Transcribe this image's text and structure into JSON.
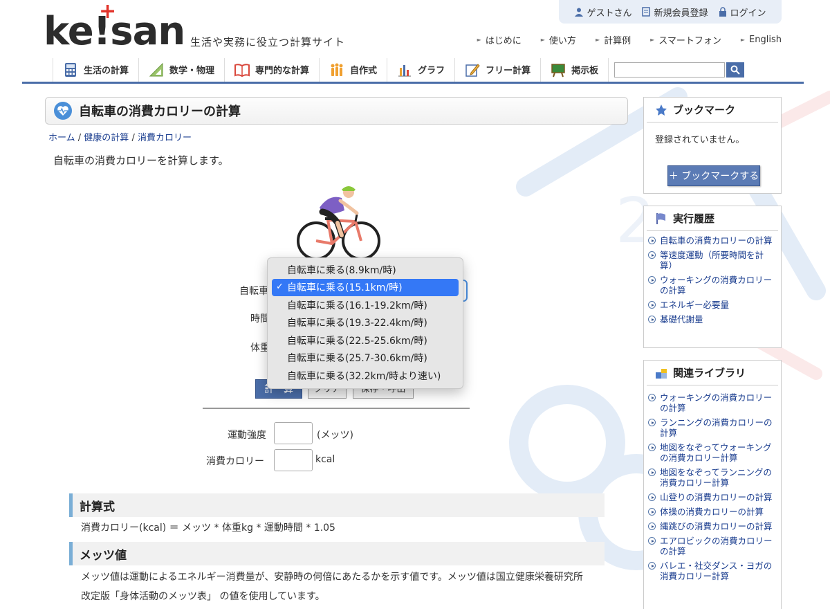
{
  "account": {
    "guest": "ゲストさん",
    "register": "新規会員登録",
    "login": "ログイン"
  },
  "logo": {
    "text_pre": "ke",
    "text_bang": "!",
    "text_post": "san",
    "tagline": "生活や実務に役立つ計算サイト"
  },
  "top_links": [
    "はじめに",
    "使い方",
    "計算例",
    "スマートフォン",
    "English"
  ],
  "nav": {
    "items": [
      "生活の計算",
      "数学・物理",
      "専門的な計算",
      "自作式",
      "グラフ",
      "フリー計算",
      "掲示板"
    ],
    "search_placeholder": ""
  },
  "page": {
    "title": "自転車の消費カロリーの計算",
    "breadcrumb": [
      "ホーム",
      "健康の計算",
      "消費カロリー"
    ],
    "breadcrumb_sep": "/",
    "description": "自転車の消費カロリーを計算します。"
  },
  "form": {
    "label_activity": "自転車",
    "label_time": "時間",
    "label_weight": "体重",
    "dropdown_options": [
      "自転車に乗る(8.9km/時)",
      "自転車に乗る(15.1km/時)",
      "自転車に乗る(16.1-19.2km/時)",
      "自転車に乗る(19.3-22.4km/時)",
      "自転車に乗る(22.5-25.6km/時)",
      "自転車に乗る(25.7-30.6km/時)",
      "自転車に乗る(32.2km/時より速い)"
    ],
    "selected_index": 1,
    "calc_button": "計　算",
    "clear_button": "クリア",
    "save_button": "保存・呼出"
  },
  "output": {
    "intensity_label": "運動強度",
    "intensity_unit": "(メッツ)",
    "calorie_label": "消費カロリー",
    "calorie_unit": "kcal"
  },
  "sections": {
    "formula_heading": "計算式",
    "formula_text": "消費カロリー(kcal) ＝ メッツ * 体重kg * 運動時間 * 1.05",
    "mets_heading": "メッツ値",
    "mets_text": "メッツ値は運動によるエネルギー消費量が、安静時の何倍にあたるかを示す値です。メッツ値は国立健康栄養研究所　改定版「身体活動のメッツ表」 の値を使用しています。"
  },
  "sidebar": {
    "bookmark_title": "ブックマーク",
    "bookmark_empty": "登録されていません。",
    "bookmark_button": "＋ ブックマークする",
    "history_title": "実行履歴",
    "history_items": [
      "自転車の消費カロリーの計算",
      "等速度運動（所要時間を計算）",
      "ウォーキングの消費カロリーの計算",
      "エネルギー必要量",
      "基礎代謝量"
    ],
    "library_title": "関連ライブラリ",
    "library_items": [
      "ウォーキングの消費カロリーの計算",
      "ランニングの消費カロリーの計算",
      "地図をなぞってウォーキングの消費カロリー計算",
      "地図をなぞってランニングの消費カロリー計算",
      "山登りの消費カロリーの計算",
      "体操の消費カロリーの計算",
      "縄跳びの消費カロリーの計算",
      "エアロビックの消費カロリーの計算",
      "バレエ・社交ダンス・ヨガの消費カロリー計算"
    ]
  },
  "colors": {
    "accent": "#4a6da8",
    "selected": "#3478f6",
    "logo_plus": "#e2332a",
    "link": "#1a3d8f"
  }
}
